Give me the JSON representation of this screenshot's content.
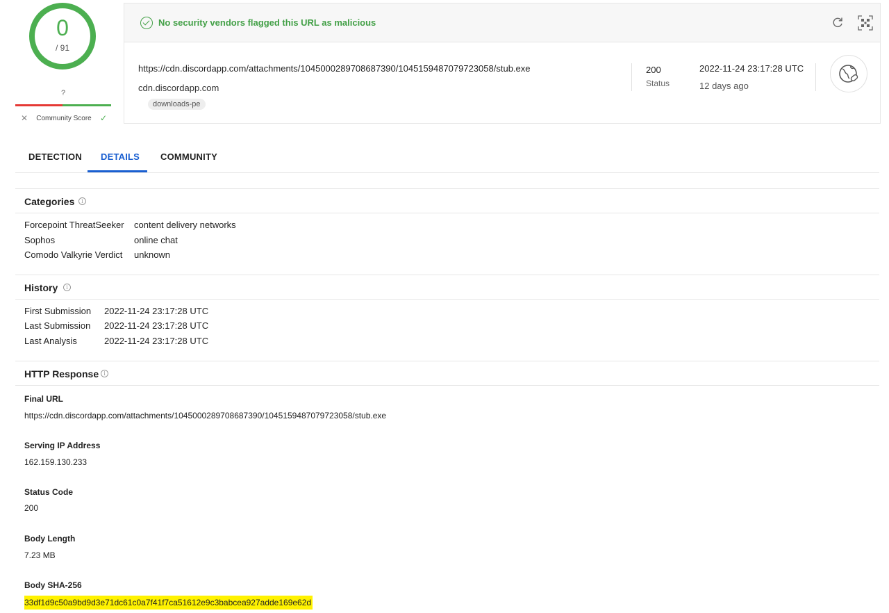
{
  "score": {
    "detections": "0",
    "total": "/ 91"
  },
  "community": {
    "question": "?",
    "label": "Community Score",
    "down": "✕",
    "up": "✓"
  },
  "summary": {
    "banner": "No security vendors flagged this URL as malicious",
    "url": "https://cdn.discordapp.com/attachments/1045000289708687390/1045159487079723058/stub.exe",
    "domain": "cdn.discordapp.com",
    "tag": "downloads-pe",
    "status_code": "200",
    "status_label": "Status",
    "date": "2022-11-24 23:17:28 UTC",
    "ago": "12 days ago",
    "accent": "#43a047"
  },
  "tabs": [
    {
      "label": "DETECTION"
    },
    {
      "label": "DETAILS"
    },
    {
      "label": "COMMUNITY"
    }
  ],
  "categories": {
    "title": "Categories",
    "rows": [
      {
        "vendor": "Forcepoint ThreatSeeker",
        "value": "content delivery networks"
      },
      {
        "vendor": "Sophos",
        "value": "online chat"
      },
      {
        "vendor": "Comodo Valkyrie Verdict",
        "value": "unknown"
      }
    ]
  },
  "history": {
    "title": "History",
    "rows": [
      {
        "label": "First Submission",
        "value": "2022-11-24 23:17:28 UTC"
      },
      {
        "label": "Last Submission",
        "value": "2022-11-24 23:17:28 UTC"
      },
      {
        "label": "Last Analysis",
        "value": "2022-11-24 23:17:28 UTC"
      }
    ]
  },
  "http": {
    "title": "HTTP Response",
    "final_url_label": "Final URL",
    "final_url": "https://cdn.discordapp.com/attachments/1045000289708687390/1045159487079723058/stub.exe",
    "ip_label": "Serving IP Address",
    "ip": "162.159.130.233",
    "status_label": "Status Code",
    "status": "200",
    "length_label": "Body Length",
    "length": "7.23 MB",
    "sha_label": "Body SHA-256",
    "sha": "33df1d9c50a9bd9d3e71dc61c0a7f41f7ca51612e9c3babcea927adde169e62d",
    "highlight_color": "#fff200"
  },
  "icons": {
    "info": "i"
  }
}
